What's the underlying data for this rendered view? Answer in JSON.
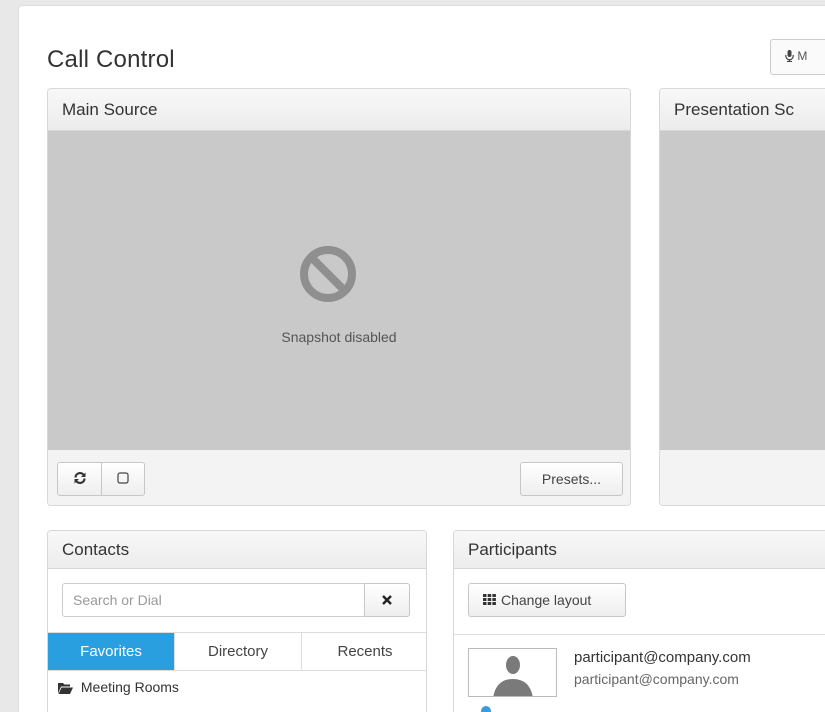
{
  "page": {
    "title": "Call Control"
  },
  "header": {
    "mute_label": "M"
  },
  "main_source": {
    "title": "Main Source",
    "snapshot_text": "Snapshot disabled",
    "presets_label": "Presets..."
  },
  "presentation_source": {
    "title": "Presentation Sc"
  },
  "contacts": {
    "title": "Contacts",
    "search_placeholder": "Search or Dial",
    "tabs": [
      {
        "label": "Favorites",
        "active": true
      },
      {
        "label": "Directory",
        "active": false
      },
      {
        "label": "Recents",
        "active": false
      }
    ],
    "items": [
      {
        "label": "Meeting Rooms",
        "icon": "folder-open-icon"
      }
    ]
  },
  "participants": {
    "title": "Participants",
    "change_layout_label": "Change layout",
    "list": [
      {
        "name": "participant@company.com",
        "address": "participant@company.com"
      }
    ]
  },
  "colors": {
    "accent": "#2a9fe0",
    "preview_bg": "#c9c9c9"
  }
}
